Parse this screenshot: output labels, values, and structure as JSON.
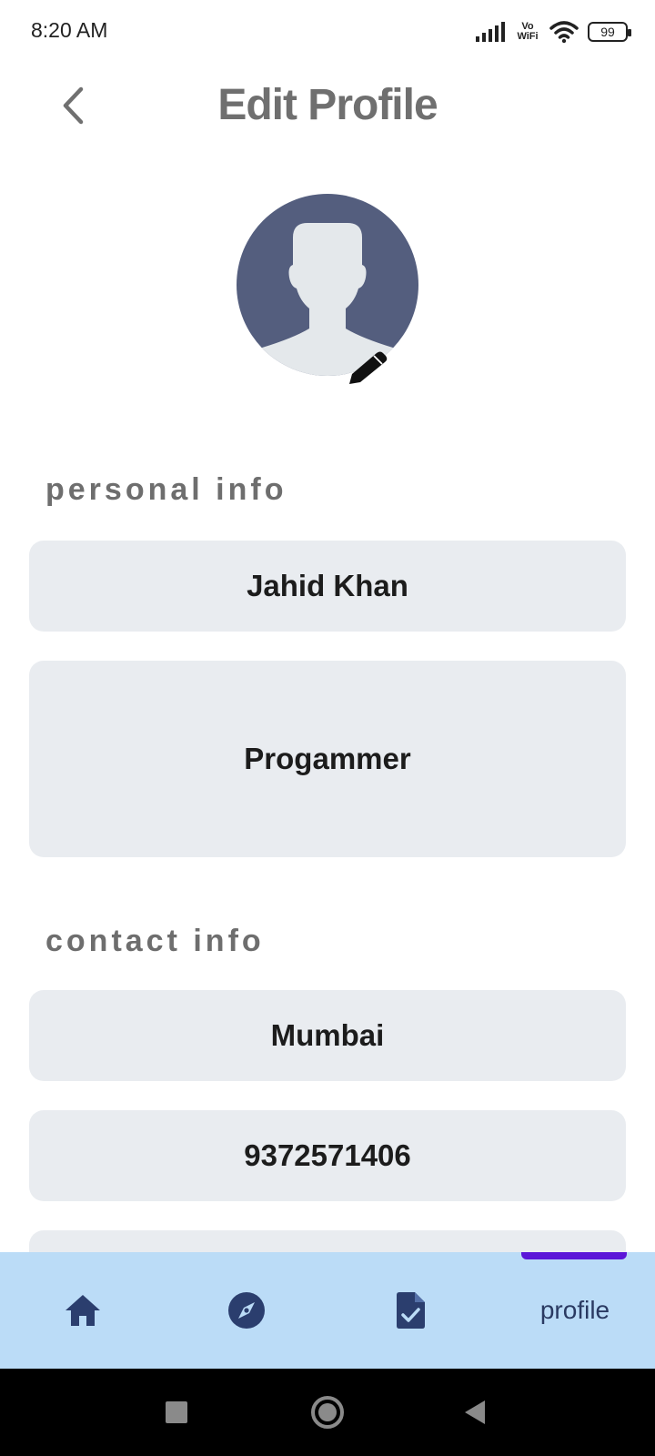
{
  "status_bar": {
    "time": "8:20 AM",
    "vowifi_line1": "Vo",
    "vowifi_line2": "WiFi",
    "battery": "99"
  },
  "header": {
    "title": "Edit Profile",
    "back_icon": "chevron-left-icon"
  },
  "avatar": {
    "icon": "default-person-icon",
    "edit_icon": "pencil-icon",
    "bg_color": "#545e7e"
  },
  "sections": {
    "personal_label": "personal info",
    "contact_label": "contact info"
  },
  "fields": {
    "name": "Jahid Khan",
    "occupation": "Progammer",
    "city": "Mumbai",
    "phone": "9372571406"
  },
  "bottom_nav": {
    "items": [
      {
        "icon": "home-icon"
      },
      {
        "icon": "compass-icon"
      },
      {
        "icon": "document-check-icon"
      },
      {
        "label": "profile"
      }
    ],
    "active_index": 3,
    "bg_color": "#bbdcf7",
    "indicator_color": "#5b16d8"
  }
}
